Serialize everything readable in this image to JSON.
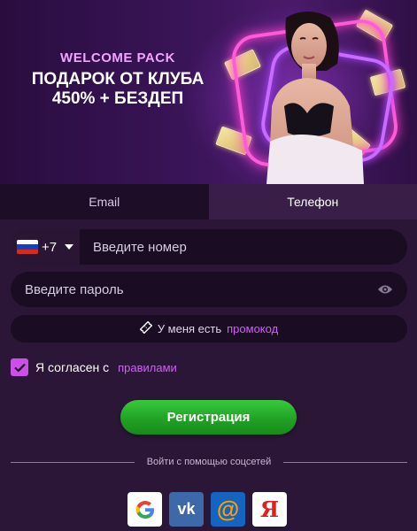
{
  "banner": {
    "welcome": "WELCOME PACK",
    "gift": "ПОДАРОК ОТ КЛУБА",
    "bonus": "450% + БЕЗДЕП"
  },
  "tabs": [
    {
      "label": "Email",
      "active": false
    },
    {
      "label": "Телефон",
      "active": true
    }
  ],
  "phone": {
    "country_flag": "russia-flag-icon",
    "dial_code": "+7",
    "placeholder": "Введите номер"
  },
  "password": {
    "placeholder": "Введите пароль",
    "toggle_icon": "eye-icon"
  },
  "promo": {
    "text": "У меня есть",
    "link": "промокод",
    "icon": "ticket-icon"
  },
  "agree": {
    "checked": true,
    "text": "Я согласен с",
    "link": "правилами"
  },
  "register": {
    "label": "Регистрация"
  },
  "social": {
    "label": "Войти с помощью соцсетей",
    "providers": [
      {
        "name": "google",
        "icon": "google-icon"
      },
      {
        "name": "vk",
        "icon": "vk-icon",
        "glyph": "vk"
      },
      {
        "name": "mail",
        "icon": "mail-ru-icon",
        "glyph": "@"
      },
      {
        "name": "yandex",
        "icon": "yandex-icon",
        "glyph": "Я"
      }
    ]
  },
  "colors": {
    "background": "#2c1637",
    "accent": "#d45cff",
    "register_green": "#22a225",
    "field_bg": "#1a0c23"
  }
}
